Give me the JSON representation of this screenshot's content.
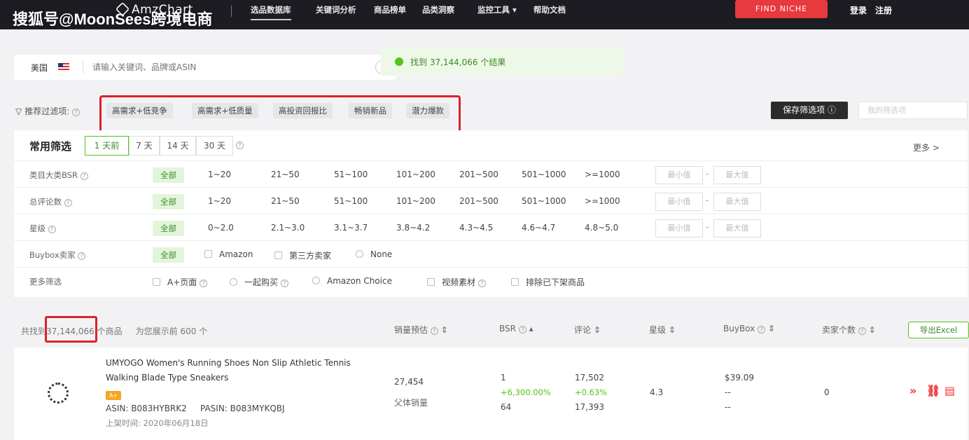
{
  "watermark": "搜狐号@MoonSees跨境电商",
  "brand": {
    "name": "AmzChart"
  },
  "nav": {
    "items": [
      "选品数据库",
      "关键词分析",
      "商品榜单",
      "品类洞察",
      "监控工具 ▾",
      "帮助文档"
    ],
    "find_niche": "FIND NICHE",
    "login": "登录",
    "register": "注册"
  },
  "search": {
    "site_label": "美国",
    "placeholder": "请输入关键词、品牌或ASIN"
  },
  "toast": {
    "text": "找到 37,144,066 个结果"
  },
  "quick_filters": {
    "label": "推荐过滤项:",
    "chips": [
      "高需求+低竞争",
      "高需求+低质量",
      "高投资回报比",
      "畅销新品",
      "潜力爆款"
    ],
    "save_button": "保存筛选项",
    "saved_placeholder": "我的筛选项"
  },
  "common_filters": {
    "title": "常用筛选",
    "day_tabs": [
      "1 天前",
      "7 天",
      "14 天",
      "30 天"
    ],
    "active_day": "1 天前",
    "more": "更多 >",
    "all_label": "全部",
    "min_placeholder": "最小值",
    "max_placeholder": "最大值",
    "rows": [
      {
        "label": "类目大类BSR",
        "options": [
          "1~20",
          "21~50",
          "51~100",
          "101~200",
          "201~500",
          "501~1000",
          ">=1000"
        ]
      },
      {
        "label": "总评论数",
        "options": [
          "1~20",
          "21~50",
          "51~100",
          "101~200",
          "201~500",
          "501~1000",
          ">=1000"
        ]
      },
      {
        "label": "星级",
        "options": [
          "0~2.0",
          "2.1~3.0",
          "3.1~3.7",
          "3.8~4.2",
          "4.3~4.5",
          "4.6~4.7",
          "4.8~5.0"
        ]
      }
    ],
    "buybox": {
      "label": "Buybox卖家",
      "options": [
        "Amazon",
        "第三方卖家",
        "None"
      ]
    },
    "features": {
      "label": "更多筛选",
      "options": [
        "A+页面",
        "一起购买",
        "Amazon Choice",
        "视频素材",
        "排除已下架商品"
      ]
    }
  },
  "results": {
    "count_prefix": "共找到",
    "count": "37,144,066",
    "count_suffix": "个商品",
    "shown_note": "为您展示前 600 个",
    "columns": [
      "销量预估",
      "BSR",
      "评论",
      "星级",
      "BuyBox",
      "卖家个数"
    ],
    "export_button": "导出Excel"
  },
  "product": {
    "title": "UMYOGO Women's Running Shoes Non Slip Athletic Tennis Walking Blade Type Sneakers",
    "badge": "A+",
    "asin": "ASIN: B083HYBRK2",
    "pasin": "PASIN: B083MYKQBJ",
    "launch_date": "上架时间: 2020年06月18日",
    "sales": "27,454",
    "sales_note": "父体销量",
    "bsr": "1",
    "bsr_change": "+6,300.00%",
    "bsr_sub": "64",
    "reviews": "17,502",
    "reviews_change": "+0.63%",
    "reviews_sub": "17,393",
    "rating": "4.3",
    "buybox_price": "$39.09",
    "buybox_line2": "--",
    "buybox_line3": "--",
    "sellers": "0"
  }
}
